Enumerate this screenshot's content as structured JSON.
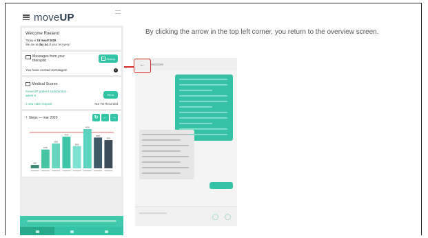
{
  "phone": {
    "logo": {
      "prefix": "move",
      "bold": "UP"
    },
    "welcome": {
      "title": "Welcome Roeland",
      "line1_prefix": "Today is ",
      "line1_date": "18 maart 2020",
      "line1_suffix": ".",
      "line2_prefix": "We are at ",
      "line2_day": "day 44",
      "line2_suffix": " of your recovery!"
    },
    "messages": {
      "title": "Messages from your therapist",
      "history_label": "History",
      "unread_text": "You have unread messages!",
      "info_glyph": "!"
    },
    "medical": {
      "title": "Medical Scores",
      "survey_label": "moveUP patient satisfaction - week 6",
      "fill_in_label": "Fill in",
      "video_request": "1 new video request",
      "video_status": "Not Yet Recorded"
    },
    "steps": {
      "title": "Steps — mar 2020",
      "refresh_glyph": "↻",
      "prev_glyph": "←",
      "next_glyph": "→"
    }
  },
  "caption": "By clicking the arrow in the top left corner, you return to the overview screen.",
  "chat": {
    "back_glyph": "←"
  },
  "colors": {
    "accent": "#34c4a5",
    "highlight": "#d82828",
    "bar_colors": [
      "#3a8a78",
      "#48c3a4",
      "#66d6bf",
      "#3fc6a8",
      "#7ee2d2",
      "#5dd3bf",
      "#3f5a6a",
      "#3c4d5a"
    ],
    "target_line": "#e05050"
  },
  "chart_data": {
    "type": "bar",
    "title": "Steps — mar 2020",
    "categories": [
      "",
      "",
      "",
      "",
      "",
      "",
      "",
      ""
    ],
    "values": [
      400,
      2200,
      2900,
      3700,
      2600,
      4600,
      3600,
      3300
    ],
    "ylim": [
      0,
      5000
    ],
    "target_value": 4200,
    "data_labels": true,
    "grid": false
  }
}
